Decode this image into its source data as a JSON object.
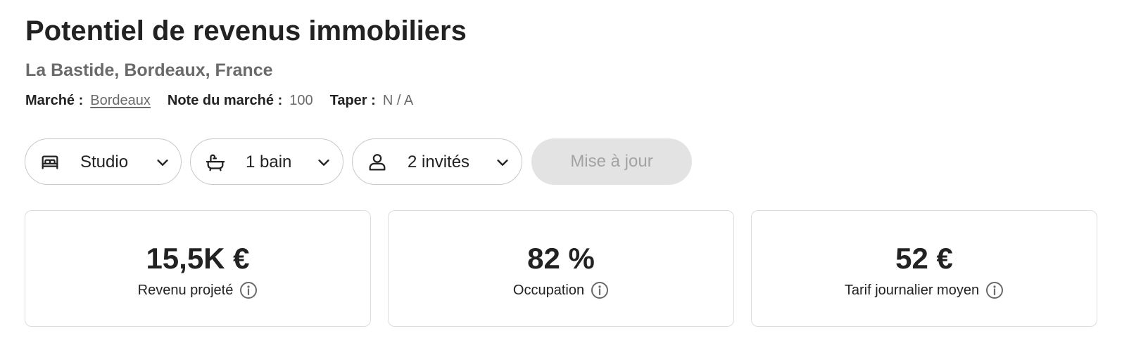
{
  "page": {
    "title": "Potentiel de revenus immobiliers",
    "location": "La Bastide, Bordeaux, France"
  },
  "meta": {
    "market_label": "Marché :",
    "market_value": "Bordeaux",
    "score_label": "Note du marché :",
    "score_value": "100",
    "type_label": "Taper :",
    "type_value": "N / A"
  },
  "filters": {
    "bedrooms": {
      "label": "Studio",
      "icon": "bed-icon"
    },
    "bathrooms": {
      "label": "1 bain",
      "icon": "bathtub-icon"
    },
    "guests": {
      "label": "2 invités",
      "icon": "person-icon"
    },
    "update_label": "Mise à jour"
  },
  "stats": [
    {
      "value": "15,5K €",
      "label": "Revenu projeté"
    },
    {
      "value": "82 %",
      "label": "Occupation"
    },
    {
      "value": "52 €",
      "label": "Tarif journalier moyen"
    }
  ],
  "colors": {
    "text_primary": "#222222",
    "text_secondary": "#6a6a6a",
    "border": "#c8c8c8",
    "button_disabled_bg": "#e3e3e3",
    "button_disabled_text": "#a3a3a3"
  }
}
